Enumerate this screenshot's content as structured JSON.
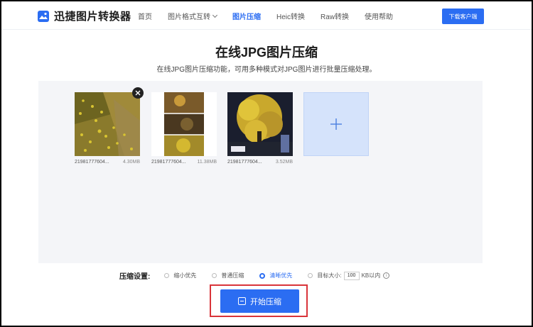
{
  "header": {
    "logo_text": "迅捷图片转换器",
    "nav": [
      {
        "label": "首页"
      },
      {
        "label": "图片格式互转",
        "has_dropdown": true
      },
      {
        "label": "图片压缩",
        "active": true
      },
      {
        "label": "Heic转换"
      },
      {
        "label": "Raw转换"
      },
      {
        "label": "使用帮助"
      }
    ],
    "download_button": "下载客户端"
  },
  "page": {
    "title": "在线JPG图片压缩",
    "subtitle": "在线JPG图片压缩功能，可用多种模式对JPG图片进行批量压缩处理。"
  },
  "files": [
    {
      "name": "21981777604...",
      "size": "4.30MB"
    },
    {
      "name": "21981777604...",
      "size": "11.38MB"
    },
    {
      "name": "21981777604...",
      "size": "3.52MB"
    }
  ],
  "add_icon": "plus-icon",
  "remove_icon": "close-icon",
  "settings": {
    "label": "压缩设置:",
    "options": [
      {
        "label": "缩小优先",
        "selected": false
      },
      {
        "label": "普通压缩",
        "selected": false
      },
      {
        "label": "清晰优先",
        "selected": true
      },
      {
        "label": "目标大小:",
        "selected": false
      }
    ],
    "target_value": "100",
    "target_unit": "KB以内",
    "info_icon": "info-icon"
  },
  "start_button": "开始压缩",
  "colors": {
    "accent": "#2b6df2",
    "highlight": "#d9343a",
    "panel_bg": "#f4f5f8",
    "add_box": "#d5e3fb"
  }
}
